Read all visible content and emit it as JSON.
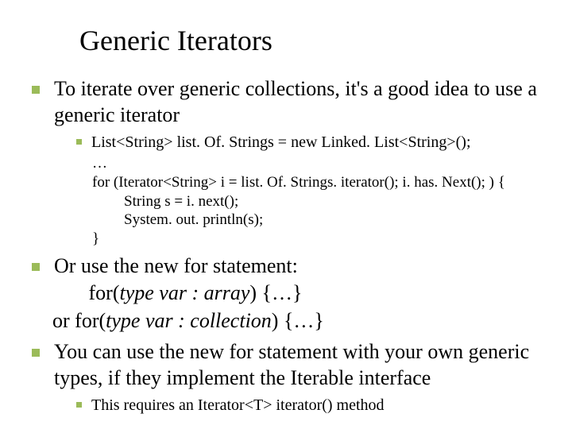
{
  "title": "Generic Iterators",
  "bullet1": "To iterate over generic collections, it's a good idea to use a generic iterator",
  "code": {
    "l1": "List<String> list. Of. Strings = new Linked. List<String>();",
    "l2": "…",
    "l3": "for (Iterator<String> i = list. Of. Strings. iterator(); i. has. Next(); ) {",
    "l4": "String s = i. next();",
    "l5": "System. out. println(s);",
    "l6": "}"
  },
  "bullet2": {
    "lead": "Or use the new ",
    "for": "for",
    "after": " statement:",
    "form1_for": "for(",
    "form1_sig": "type var : array",
    "form1_tail": ") {…}",
    "or": "or    ",
    "form2_for": "for(",
    "form2_sig": "type var : collection",
    "form2_tail": ") {…}"
  },
  "bullet3": {
    "p1": "You can use the new ",
    "for": "for",
    "p2": " statement with your own generic types, if they implement the ",
    "iterable": "Iterable",
    "p3": " interface"
  },
  "sub3": {
    "p1": "This requires an ",
    "method": "Iterator<T> iterator()",
    "p2": " method"
  }
}
